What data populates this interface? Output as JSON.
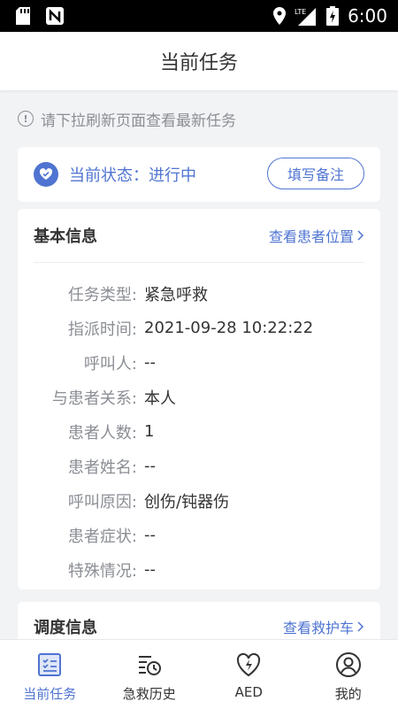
{
  "status_bar": {
    "time": "6:00",
    "network": "LTE"
  },
  "header": {
    "title": "当前任务"
  },
  "notice": {
    "text": "请下拉刷新页面查看最新任务"
  },
  "status_card": {
    "status_text": "当前状态：进行中",
    "note_button": "填写备注"
  },
  "basic_info": {
    "title": "基本信息",
    "link": "查看患者位置",
    "rows": [
      {
        "label": "任务类型:",
        "value": "紧急呼救"
      },
      {
        "label": "指派时间:",
        "value": "2021-09-28 10:22:22"
      },
      {
        "label": "呼叫人:",
        "value": "--"
      },
      {
        "label": "与患者关系:",
        "value": "本人"
      },
      {
        "label": "患者人数:",
        "value": "1"
      },
      {
        "label": "患者姓名:",
        "value": "--"
      },
      {
        "label": "呼叫原因:",
        "value": "创伤/钝器伤"
      },
      {
        "label": "患者症状:",
        "value": "--"
      },
      {
        "label": "特殊情况:",
        "value": "--"
      }
    ]
  },
  "dispatch_info": {
    "title": "调度信息",
    "link": "查看救护车"
  },
  "tabs": [
    {
      "label": "当前任务",
      "icon": "task-list-icon",
      "active": true
    },
    {
      "label": "急救历史",
      "icon": "history-icon",
      "active": false
    },
    {
      "label": "AED",
      "icon": "aed-heart-icon",
      "active": false
    },
    {
      "label": "我的",
      "icon": "profile-icon",
      "active": false
    }
  ],
  "colors": {
    "accent": "#4f74d1",
    "muted": "#8b8e94"
  }
}
